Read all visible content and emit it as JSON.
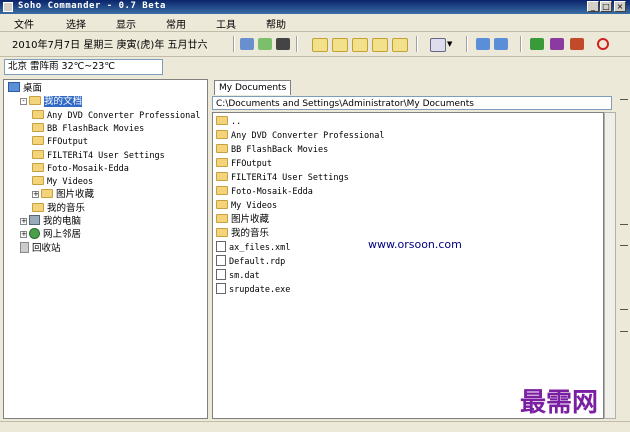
{
  "window": {
    "title": "Soho Commander - 0.7 Beta"
  },
  "menu": [
    "文件",
    "选择",
    "显示",
    "常用",
    "工具",
    "帮助"
  ],
  "toolbar": {
    "date": "2010年7月7日 星期三 庚寅(虎)年 五月廿六"
  },
  "weather": {
    "text": "北京 雷阵雨  32℃~23℃"
  },
  "tree": [
    {
      "label": "桌面",
      "icon": "desktop-icon",
      "indent": 0,
      "expander": "",
      "mono": false,
      "selected": false
    },
    {
      "label": "我的文档",
      "icon": "folder-icon",
      "indent": 1,
      "expander": "-",
      "mono": false,
      "selected": true
    },
    {
      "label": "Any DVD Converter Professional",
      "icon": "folder-icon",
      "indent": 2,
      "expander": "",
      "mono": true,
      "selected": false
    },
    {
      "label": "BB FlashBack Movies",
      "icon": "folder-icon",
      "indent": 2,
      "expander": "",
      "mono": true,
      "selected": false
    },
    {
      "label": "FFOutput",
      "icon": "folder-icon",
      "indent": 2,
      "expander": "",
      "mono": true,
      "selected": false
    },
    {
      "label": "FILTERiT4 User Settings",
      "icon": "folder-icon",
      "indent": 2,
      "expander": "",
      "mono": true,
      "selected": false
    },
    {
      "label": "Foto-Mosaik-Edda",
      "icon": "folder-icon",
      "indent": 2,
      "expander": "",
      "mono": true,
      "selected": false
    },
    {
      "label": "My Videos",
      "icon": "folder-icon",
      "indent": 2,
      "expander": "",
      "mono": true,
      "selected": false
    },
    {
      "label": "图片收藏",
      "icon": "folder-icon",
      "indent": 2,
      "expander": "+",
      "mono": false,
      "selected": false
    },
    {
      "label": "我的音乐",
      "icon": "folder-icon",
      "indent": 2,
      "expander": "",
      "mono": false,
      "selected": false
    },
    {
      "label": "我的电脑",
      "icon": "computer-icon",
      "indent": 1,
      "expander": "+",
      "mono": false,
      "selected": false
    },
    {
      "label": "网上邻居",
      "icon": "network-icon",
      "indent": 1,
      "expander": "+",
      "mono": false,
      "selected": false
    },
    {
      "label": "回收站",
      "icon": "recycle-bin-icon",
      "indent": 1,
      "expander": "",
      "mono": false,
      "selected": false
    }
  ],
  "tab": {
    "label": "My Documents"
  },
  "path": {
    "value": "C:\\Documents and Settings\\Administrator\\My Documents"
  },
  "files": [
    {
      "name": "..",
      "icon": "folder-icon",
      "mono": true
    },
    {
      "name": "Any DVD Converter Professional",
      "icon": "folder-icon",
      "mono": true
    },
    {
      "name": "BB FlashBack Movies",
      "icon": "folder-icon",
      "mono": true
    },
    {
      "name": "FFOutput",
      "icon": "folder-icon",
      "mono": true
    },
    {
      "name": "FILTERiT4 User Settings",
      "icon": "folder-icon",
      "mono": true
    },
    {
      "name": "Foto-Mosaik-Edda",
      "icon": "folder-icon",
      "mono": true
    },
    {
      "name": "My Videos",
      "icon": "folder-icon",
      "mono": true
    },
    {
      "name": "图片收藏",
      "icon": "folder-icon",
      "mono": false
    },
    {
      "name": "我的音乐",
      "icon": "folder-icon",
      "mono": false
    },
    {
      "name": "ax_files.xml",
      "icon": "file-icon",
      "mono": true
    },
    {
      "name": "Default.rdp",
      "icon": "file-icon",
      "mono": true
    },
    {
      "name": "sm.dat",
      "icon": "file-icon",
      "mono": true
    },
    {
      "name": "srupdate.exe",
      "icon": "exe-icon",
      "mono": true
    }
  ],
  "watermark": {
    "site": "www.orsoon.com",
    "brand": "最需网"
  },
  "colors": {
    "titlebar": "#0a246a",
    "selection": "#316ac5",
    "folder": "#f4d47a",
    "brand": "#7b1fa2"
  }
}
